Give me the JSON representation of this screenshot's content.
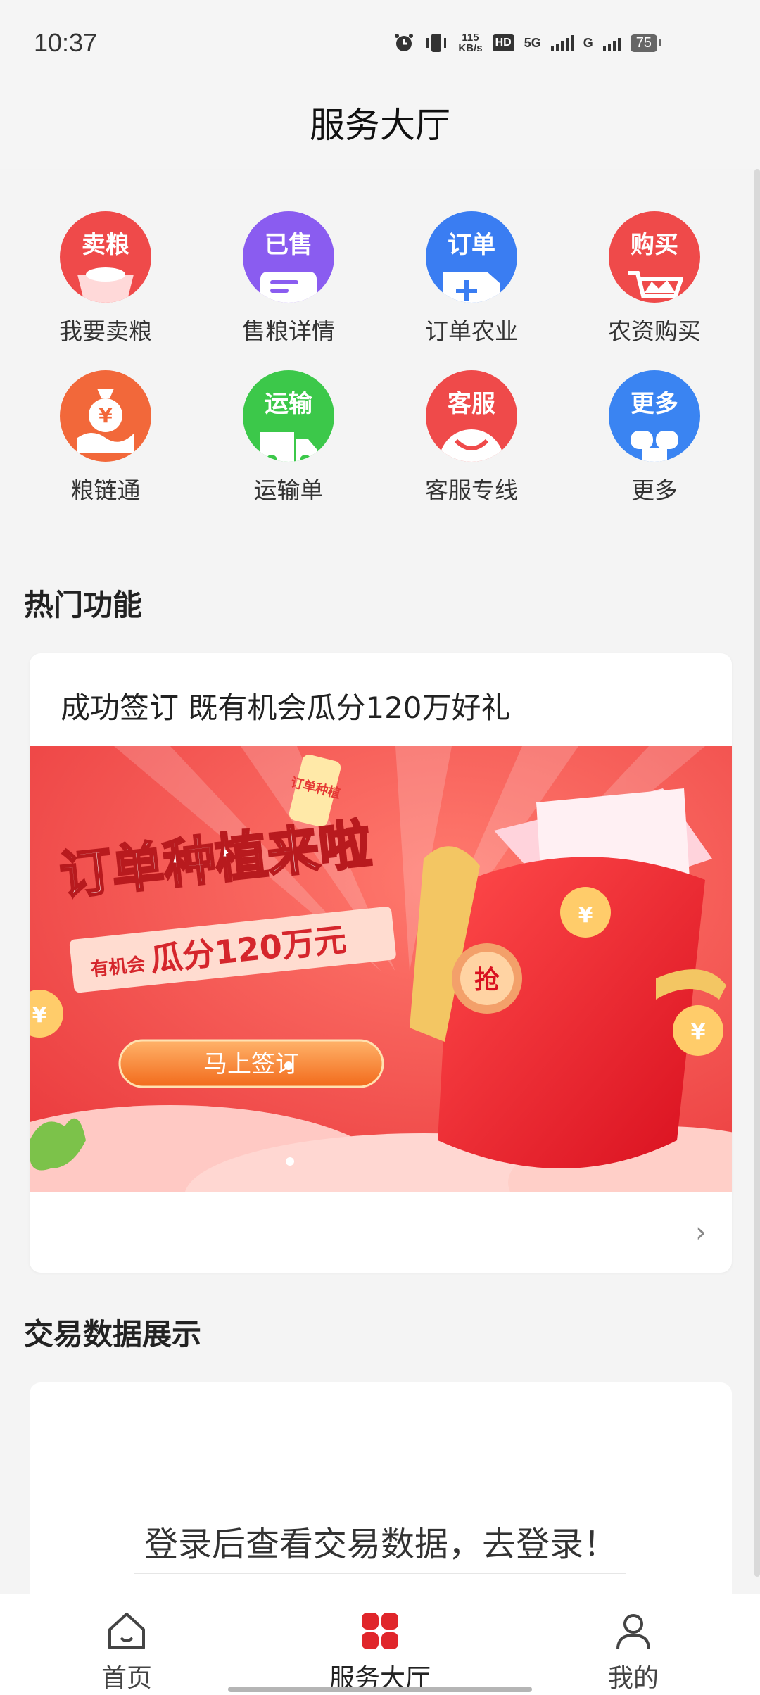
{
  "status_bar": {
    "time": "10:37",
    "net_speed_value": "115",
    "net_speed_unit": "KB/s",
    "hd_label": "HD",
    "sim1_label": "5G",
    "sim2_label": "G",
    "battery": "75"
  },
  "header": {
    "title": "服务大厅"
  },
  "services": [
    {
      "tag": "卖粮",
      "label": "我要卖粮",
      "color": "#ef4a4a"
    },
    {
      "tag": "已售",
      "label": "售粮详情",
      "color": "#8a5cf0"
    },
    {
      "tag": "订单",
      "label": "订单农业",
      "color": "#3a7df2"
    },
    {
      "tag": "购买",
      "label": "农资购买",
      "color": "#ef4a4a"
    },
    {
      "tag": "",
      "label": "粮链通",
      "color": "#f2683a"
    },
    {
      "tag": "运输",
      "label": "运输单",
      "color": "#3cc84a"
    },
    {
      "tag": "客服",
      "label": "客服专线",
      "color": "#ef4a4a"
    },
    {
      "tag": "更多",
      "label": "更多",
      "color": "#3a84f2"
    }
  ],
  "hot_section": {
    "title": "热门功能",
    "card_heading": "成功签订 既有机会瓜分120万好礼",
    "banner": {
      "headline": "订单种植来啦",
      "subline_prefix": "有机会",
      "subline_main": "瓜分120万元",
      "cta": "马上签订",
      "ticket_text": "订单种植",
      "coin_text": "抢",
      "coin_small": "¥"
    },
    "more_chevron": "›"
  },
  "data_section": {
    "title": "交易数据展示",
    "login_prompt": "登录后查看交易数据，去登录！"
  },
  "bottom_nav": {
    "items": [
      {
        "label": "首页",
        "icon": "home-icon"
      },
      {
        "label": "服务大厅",
        "icon": "grid-icon"
      },
      {
        "label": "我的",
        "icon": "person-icon"
      }
    ],
    "active_color": "#e0262b"
  }
}
